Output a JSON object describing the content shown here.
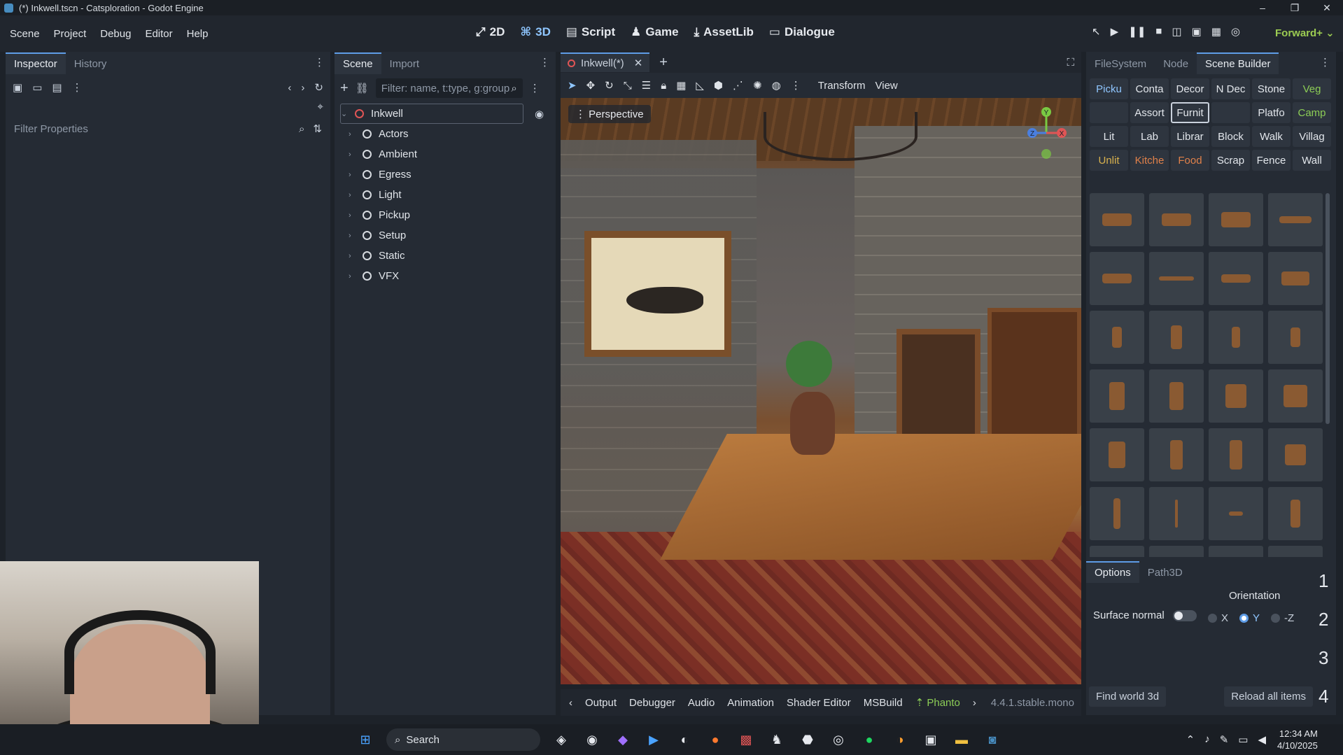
{
  "window": {
    "title": "(*) Inkwell.tscn - Catsploration - Godot Engine",
    "controls": [
      "–",
      "❐",
      "✕"
    ]
  },
  "menu": [
    "Scene",
    "Project",
    "Debug",
    "Editor",
    "Help"
  ],
  "modes": [
    {
      "icon": "⤢",
      "label": "2D"
    },
    {
      "icon": "⌘",
      "label": "3D"
    },
    {
      "icon": "▤",
      "label": "Script"
    },
    {
      "icon": "♟",
      "label": "Game"
    },
    {
      "icon": "⤓",
      "label": "AssetLib"
    },
    {
      "icon": "▭",
      "label": "Dialogue"
    }
  ],
  "renderer": "Forward+",
  "left_panel": {
    "tabs": [
      "Inspector",
      "History"
    ],
    "filter_placeholder": "Filter Properties"
  },
  "scene_panel": {
    "tabs": [
      "Scene",
      "Import"
    ],
    "filter_placeholder": "Filter: name, t:type, g:group",
    "root": "Inkwell",
    "children": [
      "Actors",
      "Ambient",
      "Egress",
      "Light",
      "Pickup",
      "Setup",
      "Static",
      "VFX"
    ]
  },
  "editor_tab": {
    "label": "Inkwell(*)"
  },
  "viewport_toolbar": {
    "transform": "Transform",
    "view": "View",
    "perspective": "Perspective"
  },
  "gizmo": {
    "y": "Y",
    "x": "X",
    "z": "Z"
  },
  "bottom_panel": {
    "tabs": [
      "Output",
      "Debugger",
      "Audio",
      "Animation",
      "Shader Editor",
      "MSBuild",
      "Phanto"
    ],
    "version": "4.4.1.stable.mono"
  },
  "right_panel": {
    "tabs": [
      "FileSystem",
      "Node",
      "Scene Builder"
    ],
    "categories": [
      {
        "label": "Picku",
        "style": "hl"
      },
      {
        "label": "Conta",
        "style": ""
      },
      {
        "label": "Decor",
        "style": ""
      },
      {
        "label": "N Dec",
        "style": ""
      },
      {
        "label": "Stone",
        "style": ""
      },
      {
        "label": "Veg",
        "style": "green"
      },
      {
        "label": "",
        "style": ""
      },
      {
        "label": "Assort",
        "style": ""
      },
      {
        "label": "Furnit",
        "style": "sel"
      },
      {
        "label": "",
        "style": ""
      },
      {
        "label": "Platfo",
        "style": ""
      },
      {
        "label": "Camp",
        "style": "green"
      },
      {
        "label": "Lit",
        "style": ""
      },
      {
        "label": "Lab",
        "style": ""
      },
      {
        "label": "Librar",
        "style": ""
      },
      {
        "label": "Block",
        "style": ""
      },
      {
        "label": "Walk",
        "style": ""
      },
      {
        "label": "Villag",
        "style": ""
      },
      {
        "label": "Unlit",
        "style": "yellow"
      },
      {
        "label": "Kitche",
        "style": "orange"
      },
      {
        "label": "Food",
        "style": "orange"
      },
      {
        "label": "Scrap",
        "style": ""
      },
      {
        "label": "Fence",
        "style": ""
      },
      {
        "label": "Wall",
        "style": ""
      }
    ],
    "options_tabs": [
      "Options",
      "Path3D"
    ],
    "orientation_label": "Orientation",
    "surface_normal_label": "Surface normal",
    "orientation_options": [
      "X",
      "Y",
      "-Z"
    ],
    "orientation_selected": "Y",
    "find_button": "Find world 3d",
    "reload_button": "Reload all items"
  },
  "side_numbers": [
    "1",
    "2",
    "3",
    "4"
  ],
  "taskbar": {
    "search": "Search"
  },
  "clock": {
    "time": "12:34 AM",
    "date": "4/10/2025"
  }
}
